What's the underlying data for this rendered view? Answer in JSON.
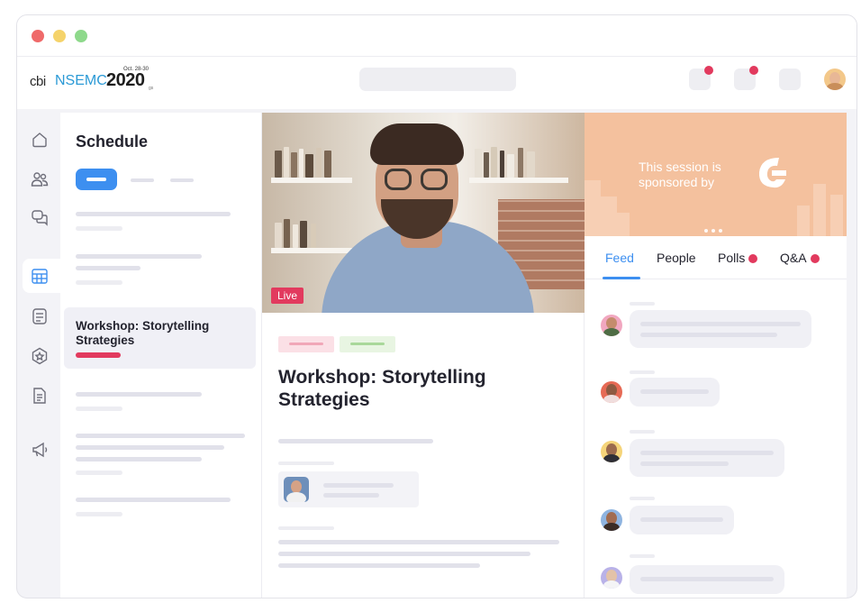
{
  "window": {
    "traffic_lights": [
      "close",
      "minimize",
      "maximize"
    ]
  },
  "header": {
    "logo": {
      "prefix": "cbi",
      "name": "NSEMC",
      "year": "2020",
      "date": "Oct. 28-30",
      "suffix": "gs"
    },
    "icons": [
      "notifications-icon",
      "messages-icon",
      "settings-icon"
    ]
  },
  "nav": {
    "items": [
      "home-icon",
      "people-icon",
      "chat-icon",
      "schedule-icon",
      "agenda-icon",
      "badge-icon",
      "document-icon",
      "announcement-icon"
    ],
    "active": "schedule-icon"
  },
  "schedule": {
    "title": "Schedule",
    "active_session": {
      "title": "Workshop: Storytelling Strategies"
    }
  },
  "session": {
    "live_label": "Live",
    "title": "Workshop: Storytelling Strategies"
  },
  "sponsor": {
    "text": "This session is sponsored by",
    "slides": 3
  },
  "tabs": [
    {
      "label": "Feed",
      "active": true,
      "dot": false
    },
    {
      "label": "People",
      "active": false,
      "dot": false
    },
    {
      "label": "Polls",
      "active": false,
      "dot": true
    },
    {
      "label": "Q&A",
      "active": false,
      "dot": true
    }
  ],
  "colors": {
    "accent": "#3d8ff0",
    "live": "#e23a5e",
    "sponsor_bg": "#f4c19e",
    "notification": "#e23a5e"
  }
}
